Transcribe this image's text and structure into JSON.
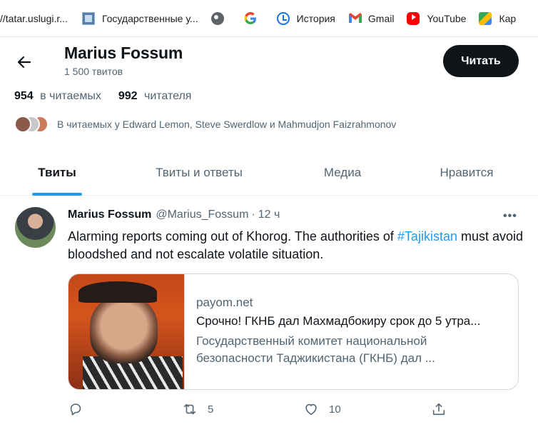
{
  "bookmarks": [
    {
      "label": "//tatar.uslugi.r...",
      "icon": "none"
    },
    {
      "label": "Государственные у...",
      "icon": "gosuslugi-icon"
    },
    {
      "label": "",
      "icon": "globe-icon"
    },
    {
      "label": "",
      "icon": "google-icon"
    },
    {
      "label": "История",
      "icon": "history-icon"
    },
    {
      "label": "Gmail",
      "icon": "gmail-icon"
    },
    {
      "label": "YouTube",
      "icon": "youtube-icon"
    },
    {
      "label": "Кар",
      "icon": "maps-icon"
    }
  ],
  "profile": {
    "name": "Marius Fossum",
    "tweet_count": "1 500 твитов",
    "follow_label": "Читать",
    "following_num": "954",
    "following_label": "в читаемых",
    "followers_num": "992",
    "followers_label": "читателя",
    "followed_by": "В читаемых у Edward Lemon, Steve Swerdlow и Mahmudjon Faizrahmonov"
  },
  "tabs": [
    {
      "label": "Твиты",
      "active": true
    },
    {
      "label": "Твиты и ответы",
      "active": false
    },
    {
      "label": "Медиа",
      "active": false
    },
    {
      "label": "Нравится",
      "active": false
    }
  ],
  "tweet": {
    "name": "Marius Fossum",
    "handle": "@Marius_Fossum",
    "separator": "·",
    "time": "12 ч",
    "more": "•••",
    "text_before": "Alarming reports coming out of Khorog. The authorities of ",
    "hashtag": "#Tajikistan",
    "text_after": " must avoid bloodshed and not escalate volatile situation.",
    "card": {
      "domain": "payom.net",
      "title": "Срочно! ГКНБ дал Махмадбокиру срок до 5 утра...",
      "description": "Государственный комитет национальной безопасности Таджикистана (ГКНБ) дал ..."
    },
    "actions": {
      "replies": "",
      "retweets": "5",
      "likes": "10"
    }
  },
  "colors": {
    "accent": "#1d9bf0",
    "text_primary": "#0f1419",
    "text_secondary": "#536471",
    "button_dark": "#0f1419"
  }
}
